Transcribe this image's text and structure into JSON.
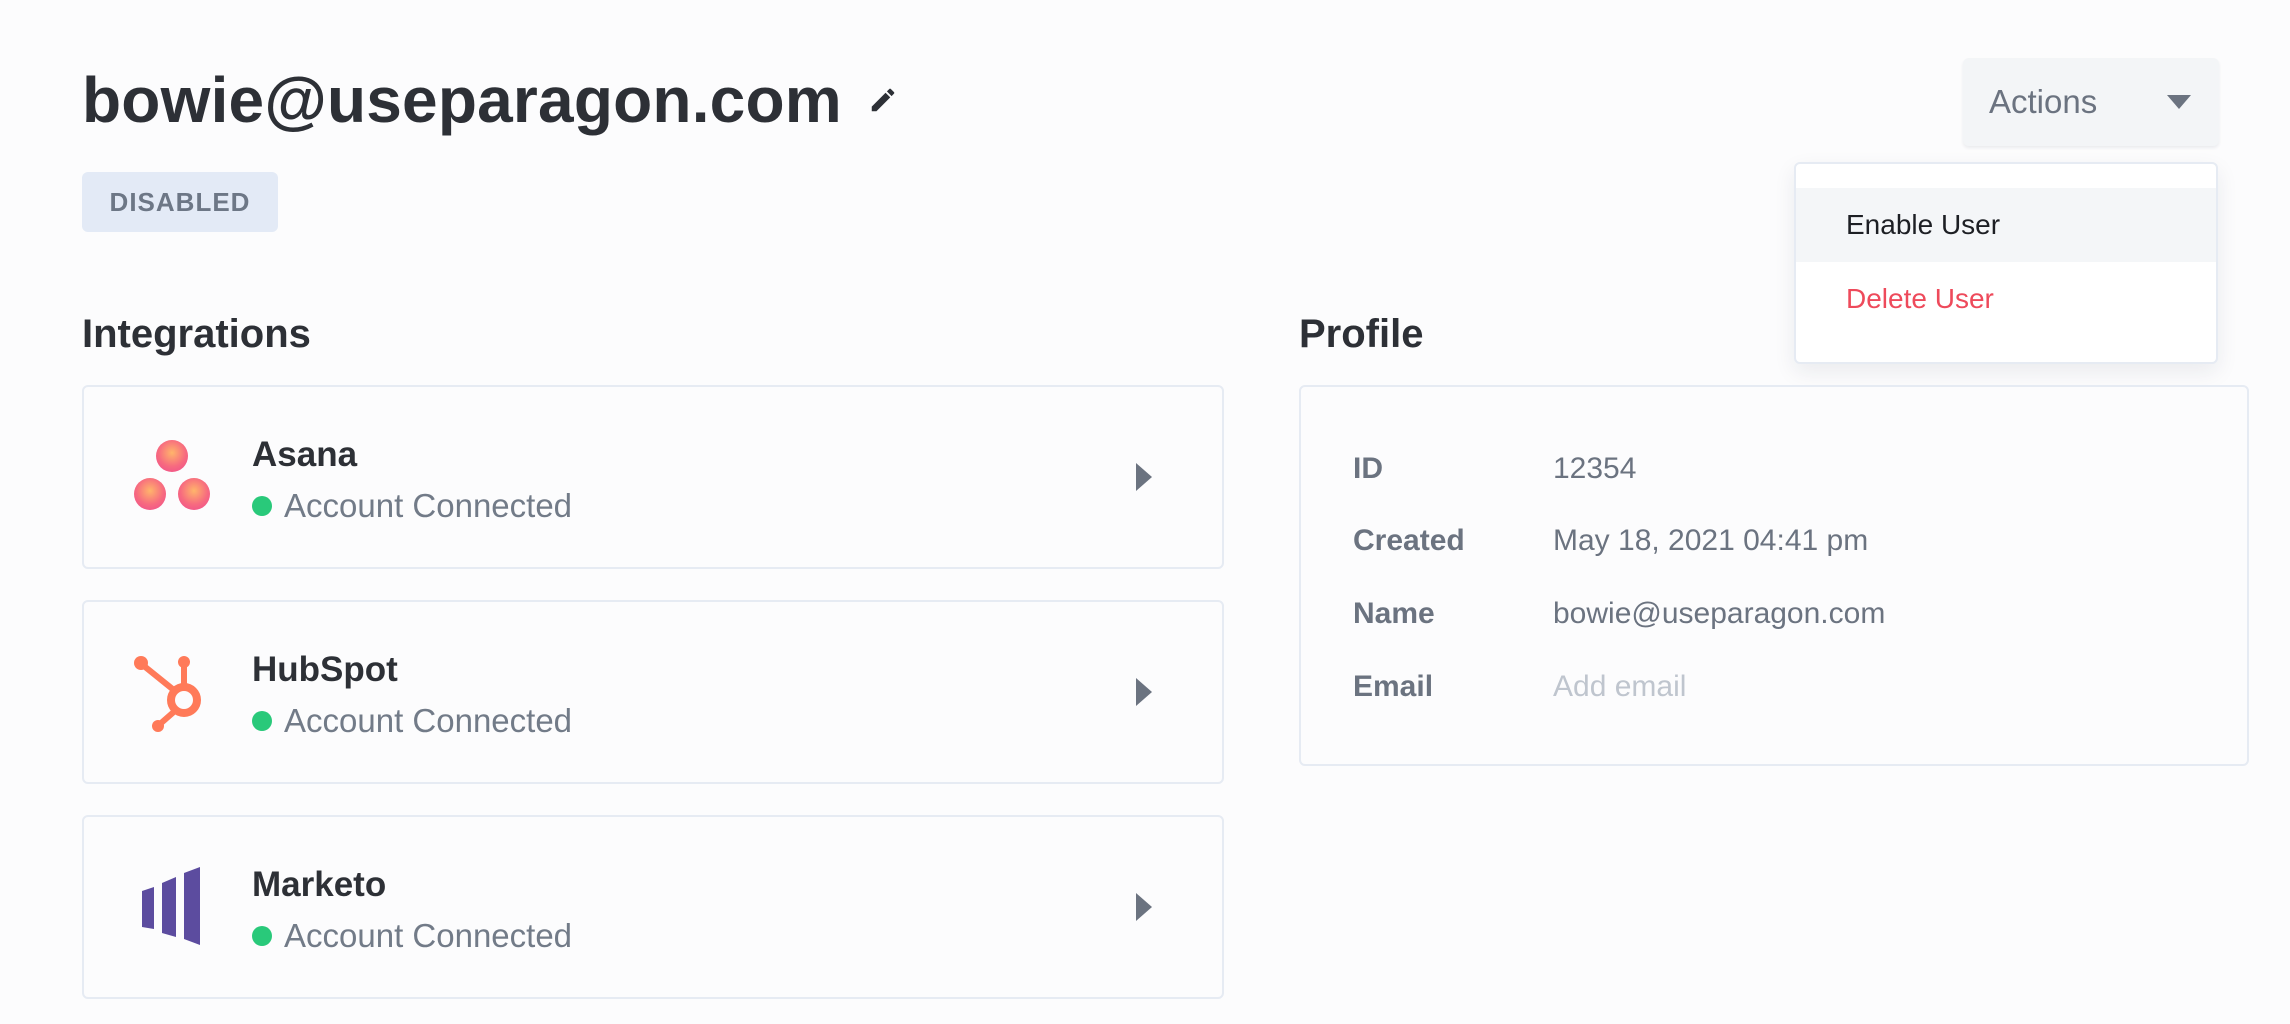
{
  "header": {
    "title": "bowie@useparagon.com",
    "status_badge": "DISABLED",
    "actions_label": "Actions"
  },
  "actions_menu": {
    "items": [
      {
        "label": "Enable User",
        "style": "hover"
      },
      {
        "label": "Delete User",
        "style": "danger"
      }
    ]
  },
  "integrations": {
    "heading": "Integrations",
    "items": [
      {
        "name": "Asana",
        "status": "Account Connected",
        "logo": "asana-logo"
      },
      {
        "name": "HubSpot",
        "status": "Account Connected",
        "logo": "hubspot-logo"
      },
      {
        "name": "Marketo",
        "status": "Account Connected",
        "logo": "marketo-logo"
      }
    ]
  },
  "profile": {
    "heading": "Profile",
    "fields": [
      {
        "key": "ID",
        "value": "12354"
      },
      {
        "key": "Created",
        "value": "May 18, 2021 04:41 pm"
      },
      {
        "key": "Name",
        "value": "bowie@useparagon.com"
      },
      {
        "key": "Email",
        "value": "Add email"
      }
    ]
  },
  "colors": {
    "status_connected": "#29c97a",
    "danger": "#ee4a5b",
    "badge_bg": "#e3eaf6",
    "asana": "#f06a6a",
    "hubspot": "#ff7a59",
    "marketo": "#5c4c9f"
  }
}
